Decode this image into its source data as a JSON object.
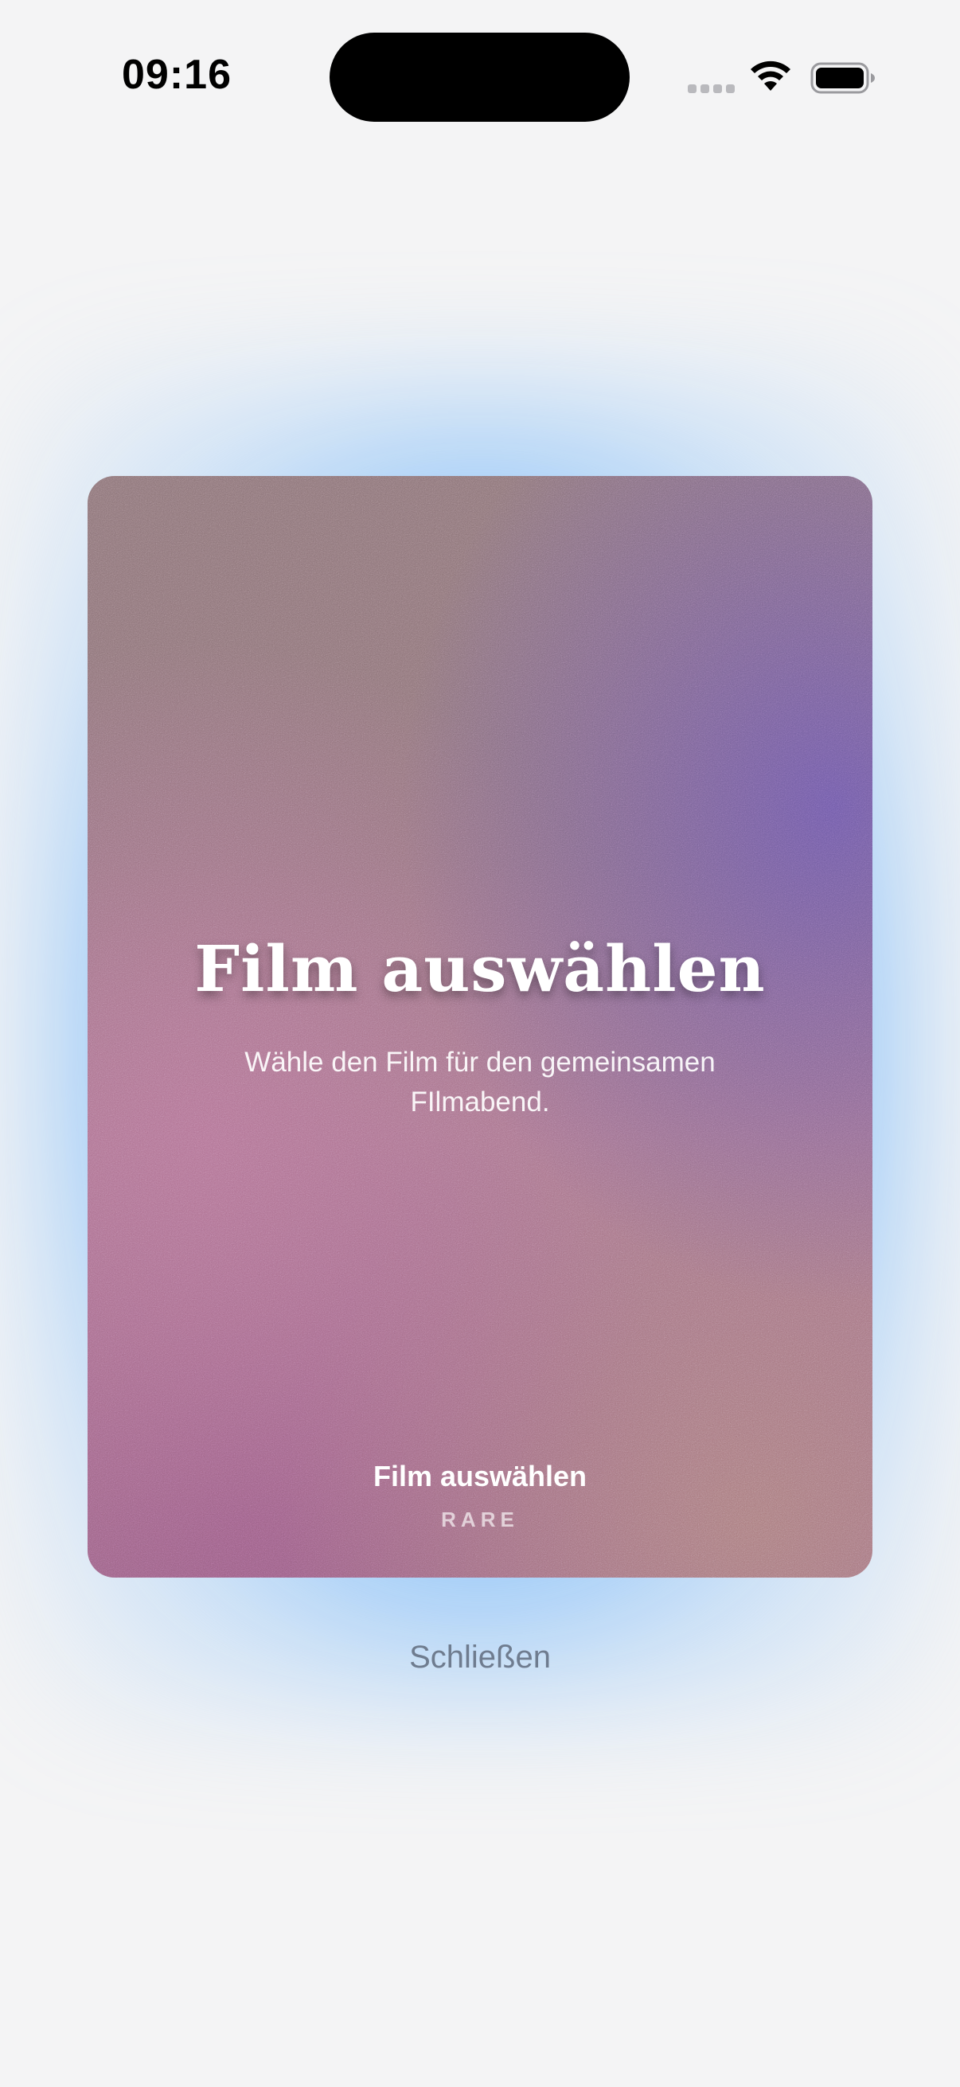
{
  "status_bar": {
    "time": "09:16",
    "icons": [
      "signal-icon",
      "wifi-icon",
      "battery-icon"
    ]
  },
  "card": {
    "title": "Film auswählen",
    "subtitle": "Wähle den Film für den gemeinsamen FIlmabend.",
    "footer_title": "Film auswählen",
    "rarity": "RARE",
    "glow_color": "#6aaef8",
    "gradient_colors": [
      "#8c7478",
      "#6e5aaa",
      "#b47396",
      "#aa7d7d"
    ]
  },
  "actions": {
    "close_label": "Schließen"
  }
}
